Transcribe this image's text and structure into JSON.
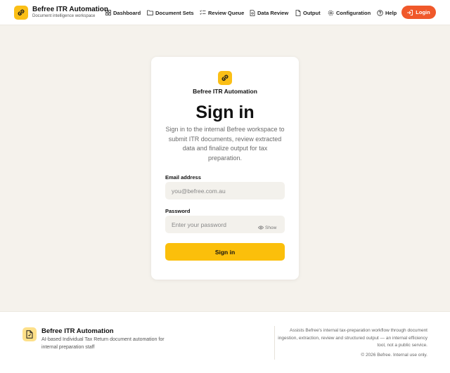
{
  "header": {
    "brand_title": "Befree ITR Automation",
    "brand_subtitle": "Document intelligence workspace",
    "nav": [
      {
        "label": "Dashboard",
        "icon": "grid-icon"
      },
      {
        "label": "Document Sets",
        "icon": "folder-icon"
      },
      {
        "label": "Review Queue",
        "icon": "checklist-icon"
      },
      {
        "label": "Data Review",
        "icon": "document-search-icon"
      },
      {
        "label": "Output",
        "icon": "file-icon"
      },
      {
        "label": "Configuration",
        "icon": "gear-icon"
      },
      {
        "label": "Help",
        "icon": "help-circle-icon"
      }
    ],
    "login_label": "Login"
  },
  "card": {
    "brand": "Befree ITR Automation",
    "title": "Sign in",
    "description": "Sign in to the internal Befree workspace to submit ITR documents, review extracted data and finalize output for tax preparation.",
    "email_label": "Email address",
    "email_placeholder": "you@befree.com.au",
    "password_label": "Password",
    "password_placeholder": "Enter your password",
    "show_label": "Show",
    "submit_label": "Sign in"
  },
  "footer": {
    "title": "Befree ITR Automation",
    "description": "AI-based Individual Tax Return document automation for internal preparation staff",
    "note": "Assists Befree's internal tax-preparation workflow through document ingestion, extraction, review and structured output — an internal efficiency tool, not a public service.",
    "copyright": "© 2026 Befree. Internal use only."
  },
  "colors": {
    "brand_yellow": "#fbbf16",
    "login_orange": "#f0582a",
    "background": "#f5f2ec"
  }
}
